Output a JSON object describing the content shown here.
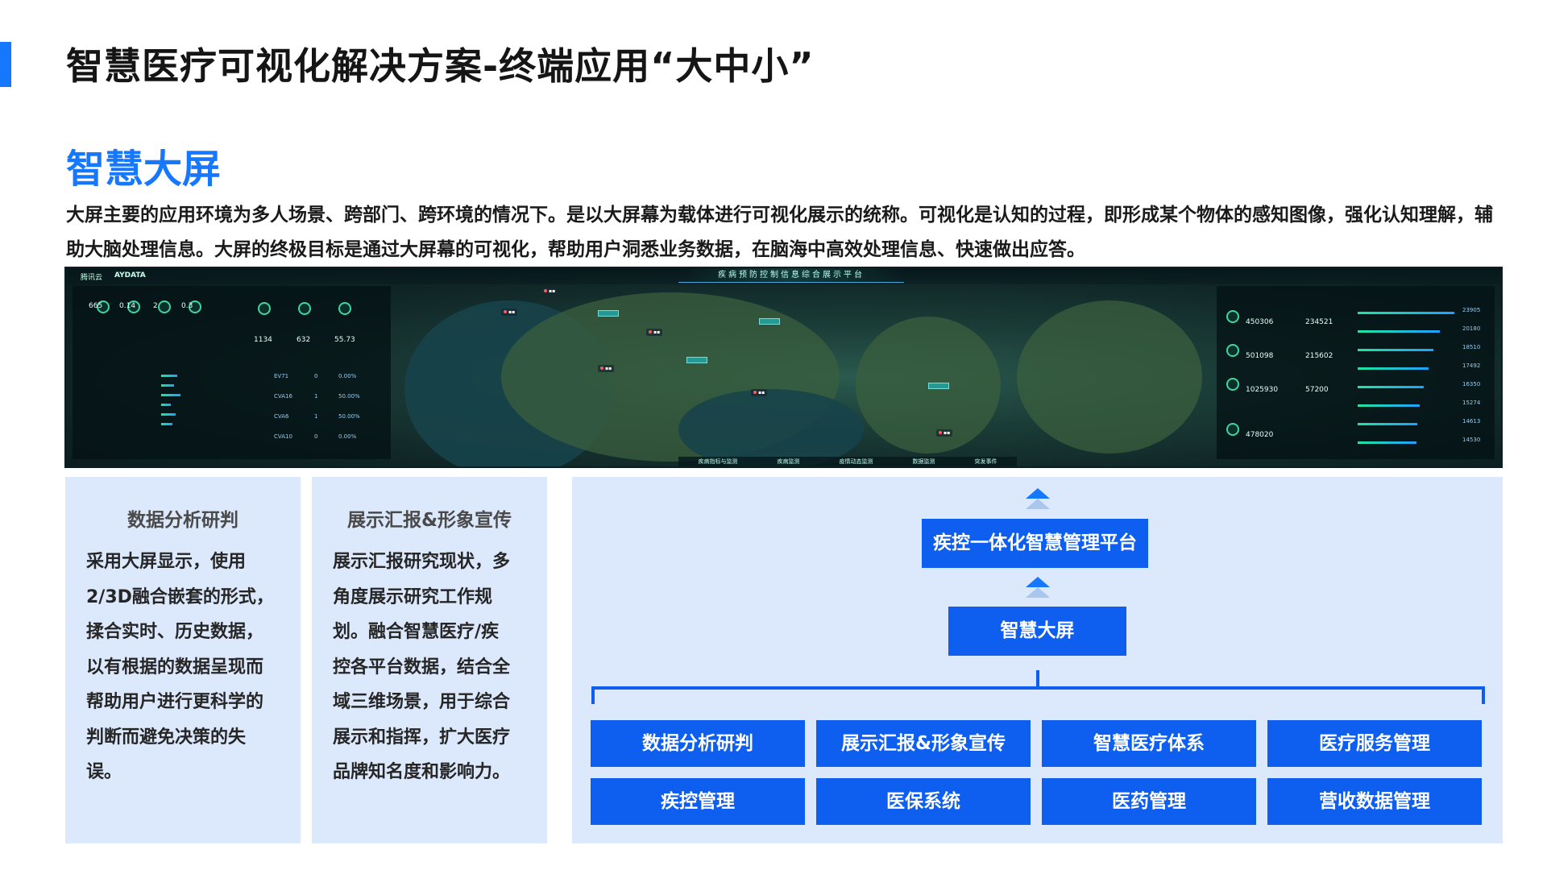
{
  "page": {
    "title": "智慧医疗可视化解决方案-终端应用“大中小”",
    "section_title": "智慧大屏",
    "intro": "大屏主要的应用环境为多人场景、跨部门、跨环境的情况下。是以大屏幕为载体进行可视化展示的统称。可视化是认知的过程，即形成某个物体的感知图像，强化认知理解，辅助大脑处理信息。大屏的终极目标是通过大屏幕的可视化，帮助用户洞悉业务数据，在脑海中高效处理信息、快速做出应答。"
  },
  "dashboard": {
    "brand": "腾讯云",
    "brand2": "AYDATA",
    "title": "疾病预防控制信息综合展示平台",
    "kpis_left": [
      "665",
      "0.14",
      "2",
      "0.3"
    ],
    "kpis_mid": [
      "1134",
      "632",
      "55.73"
    ],
    "left_rows": [
      "EV71",
      "CVA16",
      "CVA6",
      "CVA10"
    ],
    "left_row_values": [
      "0",
      "1",
      "1",
      "0"
    ],
    "left_row_pct": [
      "0.00%",
      "50.00%",
      "50.00%",
      "0.00%"
    ],
    "right_values": [
      "450306",
      "234521",
      "501098",
      "215602",
      "1025930",
      "57200",
      "478020"
    ],
    "right_bar_values": [
      "23905",
      "20180",
      "18510",
      "17492",
      "16350",
      "15274",
      "14613",
      "14530"
    ],
    "nav": [
      "疾病指标与监测",
      "疾病监测",
      "疫情动态监测",
      "数据监测",
      "突发事件"
    ]
  },
  "cards": [
    {
      "title": "数据分析研判",
      "lines": [
        "采用大屏显示，使用",
        "2/3D融合嵌套的形式，",
        "揉合实时、历史数据，",
        "以有根据的数据呈现而",
        "帮助用户进行更科学的",
        "判断而避免决策的失",
        "误。"
      ]
    },
    {
      "title": "展示汇报&形象宣传",
      "lines": [
        "展示汇报研究现状，多",
        "角度展示研究工作规",
        "划。融合智慧医疗/疾",
        "控各平台数据，结合全",
        "域三维场景，用于综合",
        "展示和指挥，扩大医疗",
        "品牌知名度和影响力。"
      ]
    }
  ],
  "diagram": {
    "top_box": "疾控一体化智慧管理平台",
    "middle_box": "智慧大屏",
    "row1": [
      "数据分析研判",
      "展示汇报&形象宣传",
      "智慧医疗体系",
      "医疗服务管理"
    ],
    "row2": [
      "疾控管理",
      "医保系统",
      "医药管理",
      "营收数据管理"
    ]
  },
  "colors": {
    "accent": "#1677ff",
    "box_blue": "#0e5ff0",
    "card_bg": "#dce8fb"
  }
}
